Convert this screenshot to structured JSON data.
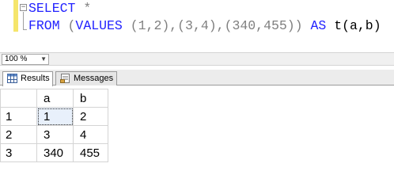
{
  "editor": {
    "line1": {
      "kw": "SELECT",
      "rest": " *"
    },
    "line2": {
      "kw1": "FROM",
      "open": " (",
      "kw2": "VALUES",
      "values_text": " (1,2),(3,4),(340,455)) ",
      "kw3": "AS",
      "alias": " t(a,b)"
    },
    "collapse_glyph": "−"
  },
  "zoom": {
    "value": "100 %",
    "arrow": "▼"
  },
  "tabs": [
    {
      "label": "Results",
      "icon": "grid-icon",
      "active": true
    },
    {
      "label": "Messages",
      "icon": "messages-icon",
      "active": false
    }
  ],
  "results": {
    "columns": [
      "a",
      "b"
    ],
    "rows": [
      {
        "num": "1",
        "a": "1",
        "b": "2"
      },
      {
        "num": "2",
        "a": "3",
        "b": "4"
      },
      {
        "num": "3",
        "a": "340",
        "b": "455"
      }
    ]
  },
  "colors": {
    "keyword": "#2323ff",
    "operator": "#808080",
    "change_bar": "#f5e56b",
    "grid_line": "#d4d4d4"
  }
}
